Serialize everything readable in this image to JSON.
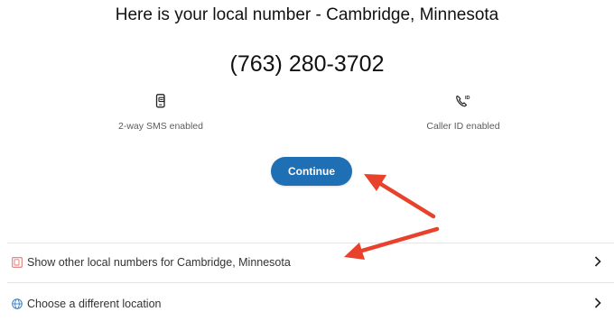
{
  "header": {
    "title": "Here is your local number - Cambridge, Minnesota",
    "phone_number": "(763) 280-3702"
  },
  "features": [
    {
      "icon": "sms-phone-icon",
      "label": "2-way SMS enabled"
    },
    {
      "icon": "caller-id-icon",
      "label": "Caller ID enabled",
      "icon_text": "ID"
    }
  ],
  "actions": {
    "continue_label": "Continue"
  },
  "options": [
    {
      "icon": "numbers-list-icon",
      "label": "Show other local numbers for Cambridge, Minnesota"
    },
    {
      "icon": "globe-icon",
      "label": "Choose a different location"
    }
  ],
  "colors": {
    "primary_button": "#1f6fb5",
    "annotation_arrow": "#e8412c",
    "option_icon": "#e07a70",
    "globe_icon": "#3b7fc4"
  }
}
